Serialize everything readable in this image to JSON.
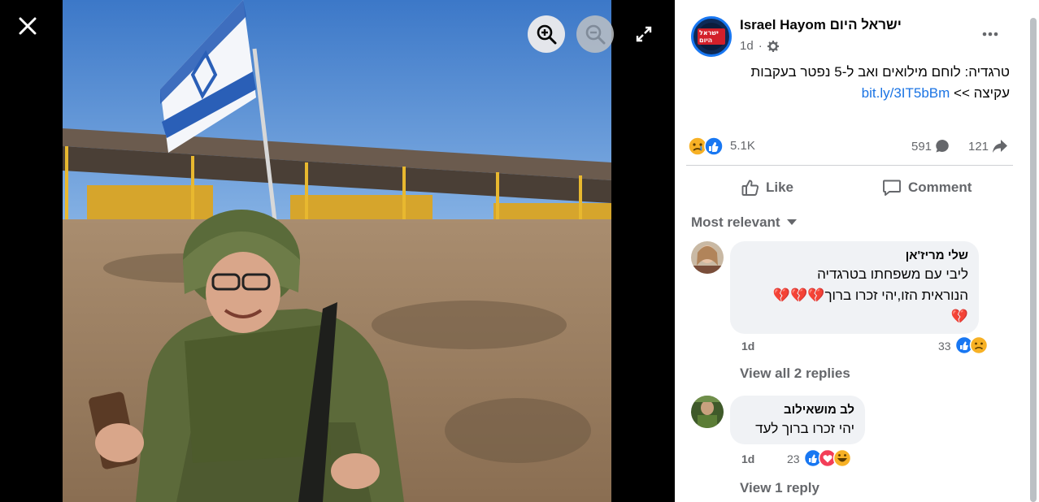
{
  "viewer": {
    "close_icon": "close-icon",
    "zoom_in_icon": "zoom-in-icon",
    "zoom_out_icon": "zoom-out-icon",
    "fullscreen_icon": "fullscreen-icon"
  },
  "post": {
    "page_name": "Israel Hayom ישראל היום",
    "logo_text": "ישראל היום",
    "time": "1d",
    "audience_icon": "gear-icon",
    "text_line1": "טרגדיה: לוחם מילואים ואב ל-5 נפטר בעקבות",
    "text_line2": "עקיצה >>",
    "link": "bit.ly/3IT5bBm",
    "reaction_count": "5.1K",
    "comment_count": "591",
    "share_count": "121"
  },
  "actions": {
    "like_label": "Like",
    "comment_label": "Comment"
  },
  "comments_sort": "Most relevant",
  "comments": [
    {
      "author": "שלי מריז'אן",
      "text_line1": "ליבי עם משפחתו בטרגדיה",
      "text_line2": "הנוראית הזו,יהי זכרו ברוך",
      "hearts_inline": "💔💔💔",
      "text_line3": "💔",
      "time": "1d",
      "reaction_count": "33",
      "view_replies": "View all 2 replies"
    },
    {
      "author": "לב מושאילוב",
      "text_line1": "יהי זכרו ברוך לעד",
      "time": "1d",
      "reaction_count": "23",
      "view_replies": "View 1 reply"
    }
  ],
  "colors": {
    "link": "#1b74e4",
    "like_blue": "#1877f2",
    "secondary_text": "#65676b",
    "bubble": "#f0f2f5"
  }
}
